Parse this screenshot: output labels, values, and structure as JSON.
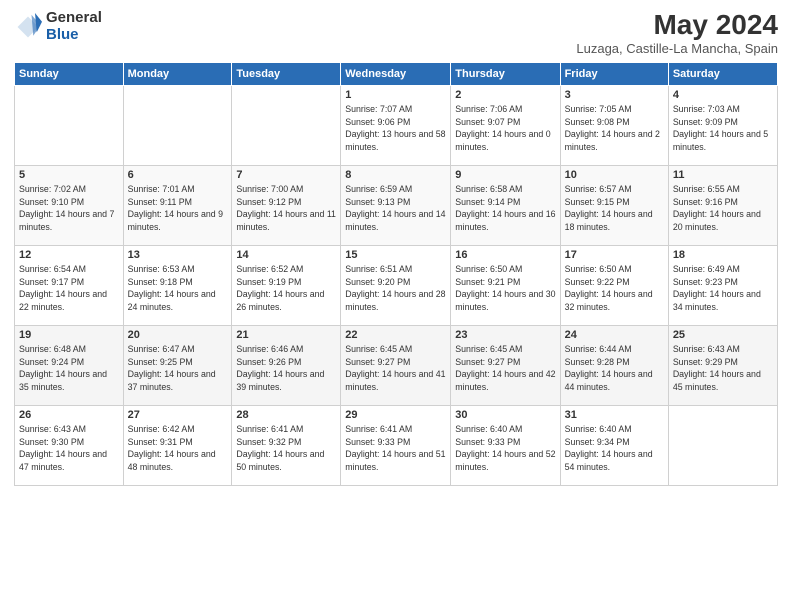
{
  "header": {
    "logo_general": "General",
    "logo_blue": "Blue",
    "title": "May 2024",
    "subtitle": "Luzaga, Castille-La Mancha, Spain"
  },
  "calendar": {
    "days_of_week": [
      "Sunday",
      "Monday",
      "Tuesday",
      "Wednesday",
      "Thursday",
      "Friday",
      "Saturday"
    ],
    "weeks": [
      [
        {
          "day": "",
          "sunrise": "",
          "sunset": "",
          "daylight": ""
        },
        {
          "day": "",
          "sunrise": "",
          "sunset": "",
          "daylight": ""
        },
        {
          "day": "",
          "sunrise": "",
          "sunset": "",
          "daylight": ""
        },
        {
          "day": "1",
          "sunrise": "Sunrise: 7:07 AM",
          "sunset": "Sunset: 9:06 PM",
          "daylight": "Daylight: 13 hours and 58 minutes."
        },
        {
          "day": "2",
          "sunrise": "Sunrise: 7:06 AM",
          "sunset": "Sunset: 9:07 PM",
          "daylight": "Daylight: 14 hours and 0 minutes."
        },
        {
          "day": "3",
          "sunrise": "Sunrise: 7:05 AM",
          "sunset": "Sunset: 9:08 PM",
          "daylight": "Daylight: 14 hours and 2 minutes."
        },
        {
          "day": "4",
          "sunrise": "Sunrise: 7:03 AM",
          "sunset": "Sunset: 9:09 PM",
          "daylight": "Daylight: 14 hours and 5 minutes."
        }
      ],
      [
        {
          "day": "5",
          "sunrise": "Sunrise: 7:02 AM",
          "sunset": "Sunset: 9:10 PM",
          "daylight": "Daylight: 14 hours and 7 minutes."
        },
        {
          "day": "6",
          "sunrise": "Sunrise: 7:01 AM",
          "sunset": "Sunset: 9:11 PM",
          "daylight": "Daylight: 14 hours and 9 minutes."
        },
        {
          "day": "7",
          "sunrise": "Sunrise: 7:00 AM",
          "sunset": "Sunset: 9:12 PM",
          "daylight": "Daylight: 14 hours and 11 minutes."
        },
        {
          "day": "8",
          "sunrise": "Sunrise: 6:59 AM",
          "sunset": "Sunset: 9:13 PM",
          "daylight": "Daylight: 14 hours and 14 minutes."
        },
        {
          "day": "9",
          "sunrise": "Sunrise: 6:58 AM",
          "sunset": "Sunset: 9:14 PM",
          "daylight": "Daylight: 14 hours and 16 minutes."
        },
        {
          "day": "10",
          "sunrise": "Sunrise: 6:57 AM",
          "sunset": "Sunset: 9:15 PM",
          "daylight": "Daylight: 14 hours and 18 minutes."
        },
        {
          "day": "11",
          "sunrise": "Sunrise: 6:55 AM",
          "sunset": "Sunset: 9:16 PM",
          "daylight": "Daylight: 14 hours and 20 minutes."
        }
      ],
      [
        {
          "day": "12",
          "sunrise": "Sunrise: 6:54 AM",
          "sunset": "Sunset: 9:17 PM",
          "daylight": "Daylight: 14 hours and 22 minutes."
        },
        {
          "day": "13",
          "sunrise": "Sunrise: 6:53 AM",
          "sunset": "Sunset: 9:18 PM",
          "daylight": "Daylight: 14 hours and 24 minutes."
        },
        {
          "day": "14",
          "sunrise": "Sunrise: 6:52 AM",
          "sunset": "Sunset: 9:19 PM",
          "daylight": "Daylight: 14 hours and 26 minutes."
        },
        {
          "day": "15",
          "sunrise": "Sunrise: 6:51 AM",
          "sunset": "Sunset: 9:20 PM",
          "daylight": "Daylight: 14 hours and 28 minutes."
        },
        {
          "day": "16",
          "sunrise": "Sunrise: 6:50 AM",
          "sunset": "Sunset: 9:21 PM",
          "daylight": "Daylight: 14 hours and 30 minutes."
        },
        {
          "day": "17",
          "sunrise": "Sunrise: 6:50 AM",
          "sunset": "Sunset: 9:22 PM",
          "daylight": "Daylight: 14 hours and 32 minutes."
        },
        {
          "day": "18",
          "sunrise": "Sunrise: 6:49 AM",
          "sunset": "Sunset: 9:23 PM",
          "daylight": "Daylight: 14 hours and 34 minutes."
        }
      ],
      [
        {
          "day": "19",
          "sunrise": "Sunrise: 6:48 AM",
          "sunset": "Sunset: 9:24 PM",
          "daylight": "Daylight: 14 hours and 35 minutes."
        },
        {
          "day": "20",
          "sunrise": "Sunrise: 6:47 AM",
          "sunset": "Sunset: 9:25 PM",
          "daylight": "Daylight: 14 hours and 37 minutes."
        },
        {
          "day": "21",
          "sunrise": "Sunrise: 6:46 AM",
          "sunset": "Sunset: 9:26 PM",
          "daylight": "Daylight: 14 hours and 39 minutes."
        },
        {
          "day": "22",
          "sunrise": "Sunrise: 6:45 AM",
          "sunset": "Sunset: 9:27 PM",
          "daylight": "Daylight: 14 hours and 41 minutes."
        },
        {
          "day": "23",
          "sunrise": "Sunrise: 6:45 AM",
          "sunset": "Sunset: 9:27 PM",
          "daylight": "Daylight: 14 hours and 42 minutes."
        },
        {
          "day": "24",
          "sunrise": "Sunrise: 6:44 AM",
          "sunset": "Sunset: 9:28 PM",
          "daylight": "Daylight: 14 hours and 44 minutes."
        },
        {
          "day": "25",
          "sunrise": "Sunrise: 6:43 AM",
          "sunset": "Sunset: 9:29 PM",
          "daylight": "Daylight: 14 hours and 45 minutes."
        }
      ],
      [
        {
          "day": "26",
          "sunrise": "Sunrise: 6:43 AM",
          "sunset": "Sunset: 9:30 PM",
          "daylight": "Daylight: 14 hours and 47 minutes."
        },
        {
          "day": "27",
          "sunrise": "Sunrise: 6:42 AM",
          "sunset": "Sunset: 9:31 PM",
          "daylight": "Daylight: 14 hours and 48 minutes."
        },
        {
          "day": "28",
          "sunrise": "Sunrise: 6:41 AM",
          "sunset": "Sunset: 9:32 PM",
          "daylight": "Daylight: 14 hours and 50 minutes."
        },
        {
          "day": "29",
          "sunrise": "Sunrise: 6:41 AM",
          "sunset": "Sunset: 9:33 PM",
          "daylight": "Daylight: 14 hours and 51 minutes."
        },
        {
          "day": "30",
          "sunrise": "Sunrise: 6:40 AM",
          "sunset": "Sunset: 9:33 PM",
          "daylight": "Daylight: 14 hours and 52 minutes."
        },
        {
          "day": "31",
          "sunrise": "Sunrise: 6:40 AM",
          "sunset": "Sunset: 9:34 PM",
          "daylight": "Daylight: 14 hours and 54 minutes."
        },
        {
          "day": "",
          "sunrise": "",
          "sunset": "",
          "daylight": ""
        }
      ]
    ]
  }
}
